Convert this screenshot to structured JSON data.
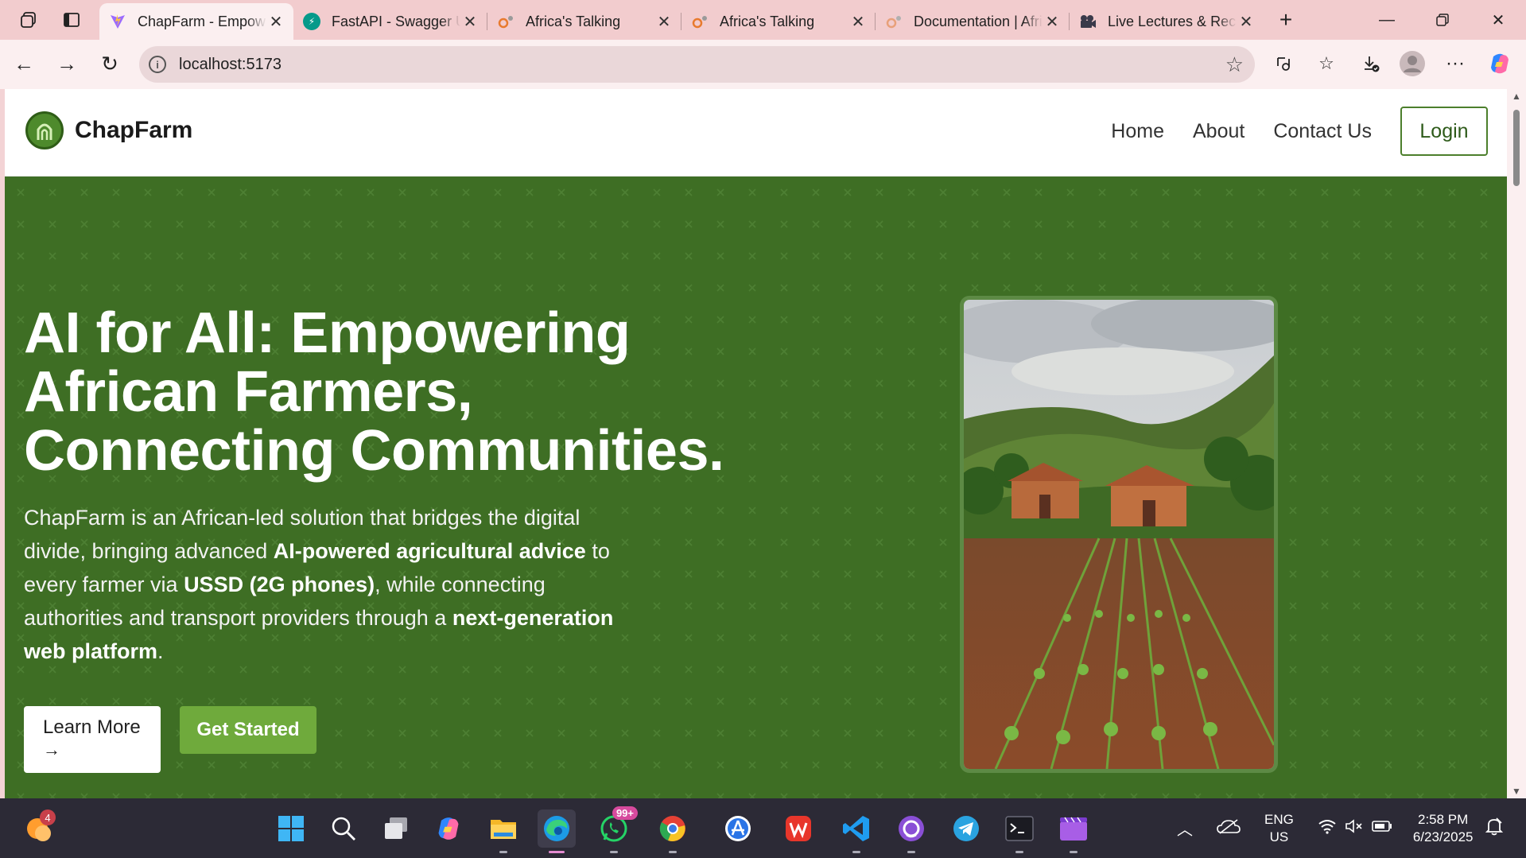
{
  "browser": {
    "tabs": [
      {
        "title": "ChapFarm - Empowering",
        "active": true,
        "favicon": "vite-icon"
      },
      {
        "title": "FastAPI - Swagger UI",
        "active": false,
        "favicon": "fastapi-icon"
      },
      {
        "title": "Africa's Talking",
        "active": false,
        "favicon": "africas-talking-icon"
      },
      {
        "title": "Africa's Talking",
        "active": false,
        "favicon": "africas-talking-icon"
      },
      {
        "title": "Documentation | Africa's Talking",
        "active": false,
        "favicon": "africas-talking-icon"
      },
      {
        "title": "Live Lectures & Recordings",
        "active": false,
        "favicon": "video-icon"
      }
    ],
    "url": "localhost:5173"
  },
  "site": {
    "brand": "ChapFarm",
    "nav": {
      "home": "Home",
      "about": "About",
      "contact": "Contact Us",
      "login": "Login"
    }
  },
  "hero": {
    "title_lines": [
      "AI for All: Empowering",
      "African Farmers,",
      "Connecting Communities."
    ],
    "desc": {
      "p1": "ChapFarm is an African-led solution that bridges the digital divide, bringing advanced ",
      "b1": "AI-powered agricultural advice",
      "p2": " to every farmer via ",
      "b2": "USSD (2G phones)",
      "p3": ", while connecting authorities and transport providers through a ",
      "b3": "next-generation web platform",
      "p4": "."
    },
    "learn_more": "Learn More",
    "get_started": "Get Started"
  },
  "taskbar": {
    "weather_badge": "4",
    "whatsapp_badge": "99+",
    "lang_top": "ENG",
    "lang_bottom": "US",
    "time": "2:58 PM",
    "date": "6/23/2025"
  },
  "colors": {
    "hero_green": "#3e6e24",
    "button_green": "#6faa3c",
    "brand_green": "#4e8a2c",
    "tab_bar": "#f2ccce"
  }
}
